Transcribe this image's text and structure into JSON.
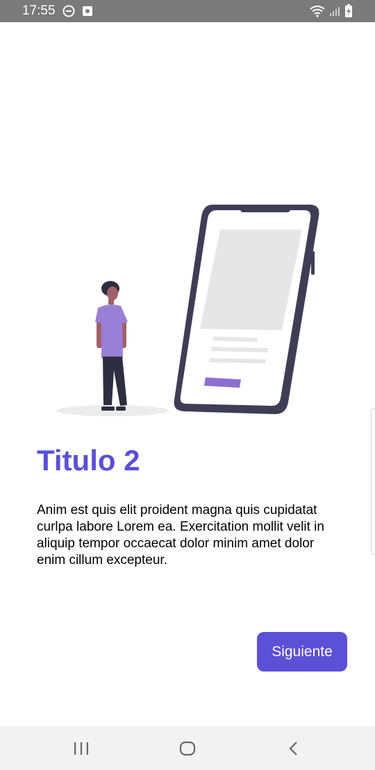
{
  "status_bar": {
    "time": "17:55",
    "icons_left": [
      "do-not-disturb-icon",
      "notification-icon"
    ],
    "icons_right": [
      "wifi-icon",
      "signal-icon",
      "battery-charging-icon"
    ],
    "background": "#7a7a7a"
  },
  "onboarding": {
    "title": "Titulo 2",
    "body": "Anim est quis elit proident magna quis cupidatat curlpa labore Lorem ea. Exercitation mollit velit in aliquip tempor occaecat dolor minim amet dolor enim cillum excepteur.",
    "next_label": "Siguiente"
  },
  "colors": {
    "accent": "#5b50d6",
    "phone_frame": "#3f3d56",
    "shirt": "#9a7fd6"
  },
  "nav_bar": {
    "buttons": [
      "recent-apps-icon",
      "home-icon",
      "back-icon"
    ]
  }
}
